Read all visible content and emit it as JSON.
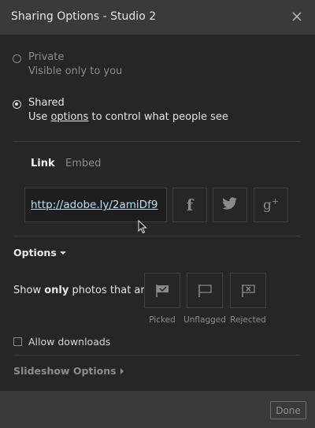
{
  "dialog": {
    "title": "Sharing Options - Studio 2",
    "close_icon": "close-icon"
  },
  "privacy": {
    "private_label": "Private",
    "private_sub": "Visible only to you",
    "shared_label": "Shared",
    "shared_sub_prefix": "Use",
    "shared_sub_link": "options",
    "shared_sub_suffix": "to control what people see",
    "selected": "Shared"
  },
  "tabs": {
    "link": "Link",
    "embed": "Embed",
    "active": "Link"
  },
  "link": {
    "url": "http://adobe.ly/2amiDf9"
  },
  "share_buttons": [
    {
      "icon": "facebook-icon",
      "glyph": "f"
    },
    {
      "icon": "twitter-icon",
      "glyph": ""
    },
    {
      "icon": "google-plus-icon",
      "glyph": "g+"
    }
  ],
  "options": {
    "header": "Options",
    "show_prefix": "Show",
    "show_bold": "only",
    "show_suffix": "photos that are",
    "flags": [
      {
        "label": "Picked",
        "icon": "picked-flag-icon"
      },
      {
        "label": "Unflagged",
        "icon": "unflagged-flag-icon"
      },
      {
        "label": "Rejected",
        "icon": "rejected-flag-icon"
      }
    ],
    "allow_downloads": "Allow downloads",
    "allow_downloads_checked": false
  },
  "slideshow": {
    "label": "Slideshow Options"
  },
  "footer": {
    "done": "Done"
  },
  "colors": {
    "background": "#262626",
    "titlebar": "#3a3a3a",
    "link": "#bfe0f2"
  }
}
